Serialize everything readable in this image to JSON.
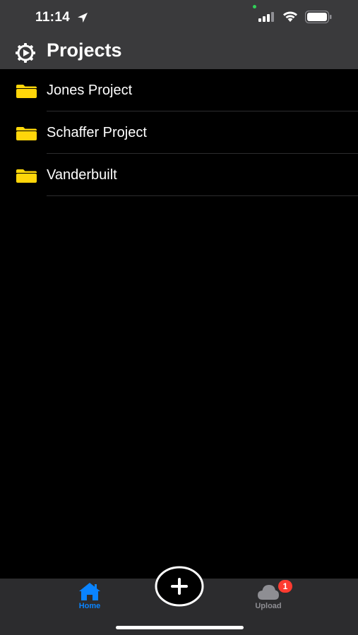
{
  "status_bar": {
    "time": "11:14",
    "icons": [
      "location-arrow-icon",
      "cellular-signal-icon",
      "wifi-icon",
      "battery-icon"
    ]
  },
  "header": {
    "title": "Projects",
    "settings_icon": "gear-icon"
  },
  "projects": [
    {
      "label": "Jones Project",
      "icon": "folder-icon"
    },
    {
      "label": "Schaffer Project",
      "icon": "folder-icon"
    },
    {
      "label": "Vanderbuilt",
      "icon": "folder-icon"
    }
  ],
  "tab_bar": {
    "home": {
      "label": "Home",
      "icon": "house-icon",
      "selected": true
    },
    "add": {
      "icon": "plus-circle-icon"
    },
    "upload": {
      "label": "Upload",
      "icon": "cloud-icon",
      "badge": "1"
    }
  },
  "colors": {
    "background": "#000000",
    "header": "#3a3a3c",
    "folder": "#ffd60a",
    "accent": "#0a84ff",
    "badge": "#ff3b30",
    "tab_bar": "#2c2c2e"
  }
}
